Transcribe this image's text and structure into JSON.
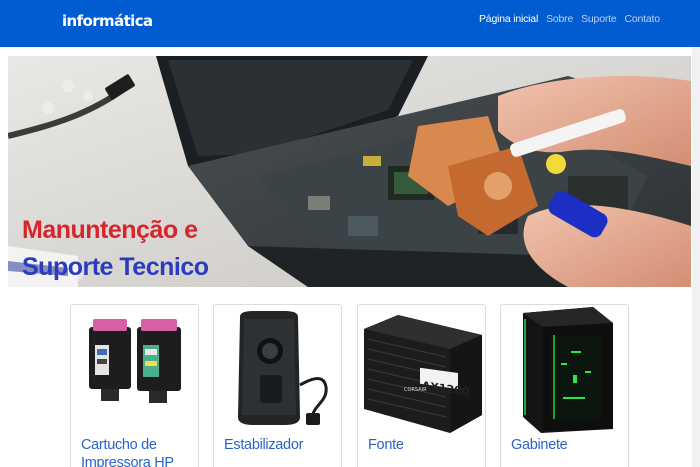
{
  "navbar": {
    "brand": "informática",
    "links": [
      {
        "label": "Página inicial",
        "active": true
      },
      {
        "label": "Sobre",
        "active": false
      },
      {
        "label": "Suporte",
        "active": false
      },
      {
        "label": "Contato",
        "active": false
      }
    ],
    "color": "#005cd0"
  },
  "hero": {
    "line1": "Manuntenção e",
    "line2": "Suporte Tecnico",
    "line1_color": "#d8242b",
    "line2_color": "#2a3bbd"
  },
  "products": [
    {
      "title": "Cartucho de Impressora HP",
      "icon": "ink-cartridges-icon"
    },
    {
      "title": "Estabilizador",
      "icon": "voltage-stabilizer-icon"
    },
    {
      "title": "Fonte",
      "icon": "power-supply-icon"
    },
    {
      "title": "Gabinete",
      "icon": "pc-case-icon"
    }
  ],
  "colors": {
    "link": "#2a63c8"
  }
}
